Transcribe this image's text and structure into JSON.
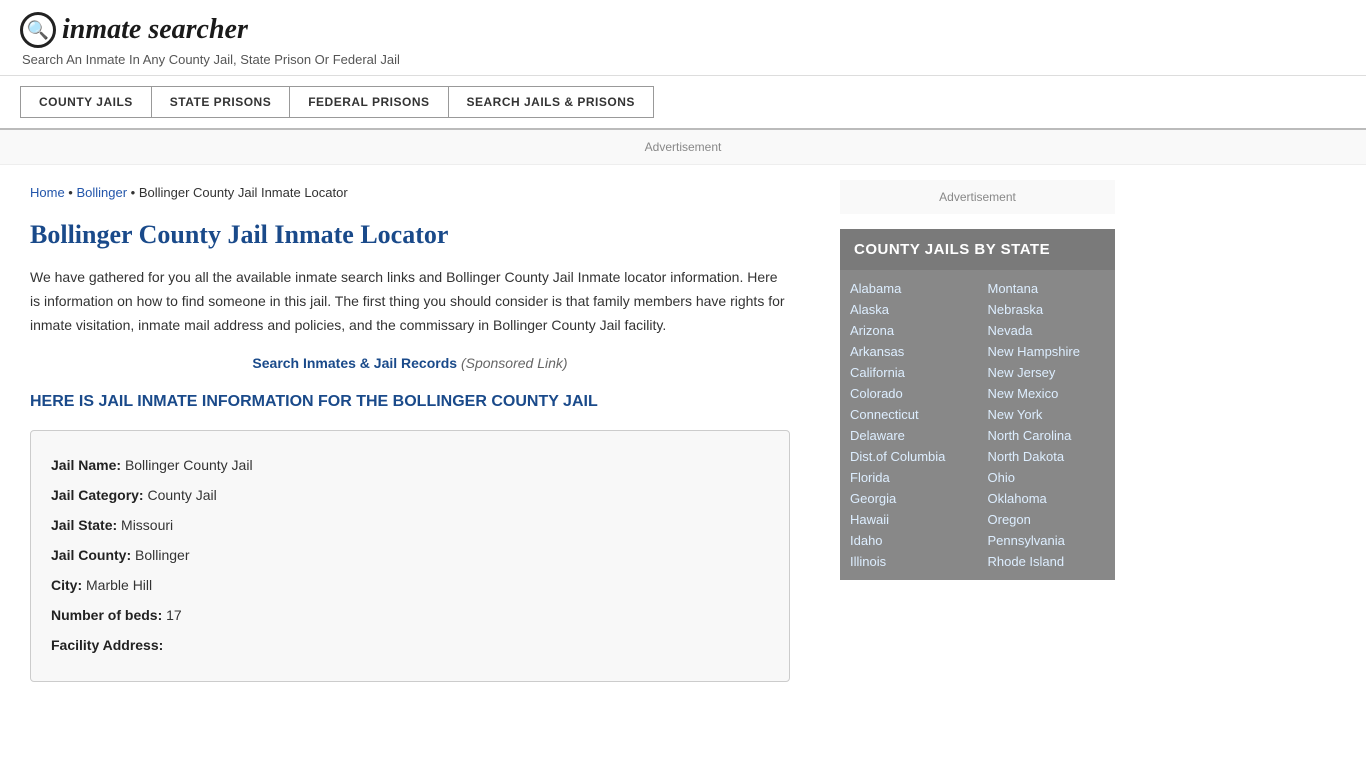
{
  "header": {
    "logo_icon": "🔍",
    "logo_text": "inmate searcher",
    "tagline": "Search An Inmate In Any County Jail, State Prison Or Federal Jail"
  },
  "nav": {
    "items": [
      {
        "label": "COUNTY JAILS"
      },
      {
        "label": "STATE PRISONS"
      },
      {
        "label": "FEDERAL PRISONS"
      },
      {
        "label": "SEARCH JAILS & PRISONS"
      }
    ]
  },
  "ad_banner": "Advertisement",
  "breadcrumb": {
    "home": "Home",
    "parent": "Bollinger",
    "current": "Bollinger County Jail Inmate Locator"
  },
  "page": {
    "title": "Bollinger County Jail Inmate Locator",
    "description": "We have gathered for you all the available inmate search links and Bollinger County Jail Inmate locator information. Here is information on how to find someone in this jail. The first thing you should consider is that family members have rights for inmate visitation, inmate mail address and policies, and the commissary in Bollinger County Jail facility.",
    "sponsored_link_text": "Search Inmates & Jail Records",
    "sponsored_label": "(Sponsored Link)",
    "subheading": "HERE IS JAIL INMATE INFORMATION FOR THE BOLLINGER COUNTY JAIL"
  },
  "jail_info": {
    "name_label": "Jail Name:",
    "name_value": "Bollinger County Jail",
    "category_label": "Jail Category:",
    "category_value": "County Jail",
    "state_label": "Jail State:",
    "state_value": "Missouri",
    "county_label": "Jail County:",
    "county_value": "Bollinger",
    "city_label": "City:",
    "city_value": "Marble Hill",
    "beds_label": "Number of beds:",
    "beds_value": "17",
    "address_label": "Facility Address:"
  },
  "sidebar": {
    "ad_text": "Advertisement",
    "state_box_title": "COUNTY JAILS BY STATE",
    "states_left": [
      "Alabama",
      "Alaska",
      "Arizona",
      "Arkansas",
      "California",
      "Colorado",
      "Connecticut",
      "Delaware",
      "Dist.of Columbia",
      "Florida",
      "Georgia",
      "Hawaii",
      "Idaho",
      "Illinois"
    ],
    "states_right": [
      "Montana",
      "Nebraska",
      "Nevada",
      "New Hampshire",
      "New Jersey",
      "New Mexico",
      "New York",
      "North Carolina",
      "North Dakota",
      "Ohio",
      "Oklahoma",
      "Oregon",
      "Pennsylvania",
      "Rhode Island"
    ]
  }
}
